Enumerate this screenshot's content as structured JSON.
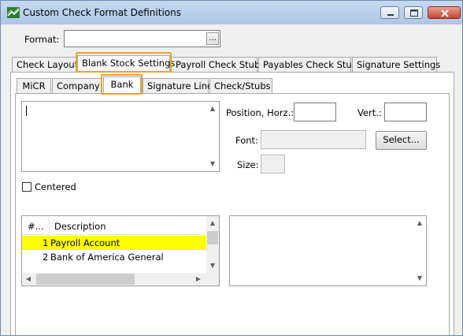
{
  "window": {
    "title": "Custom Check Format Definitions",
    "icon": "app-flag-icon"
  },
  "format": {
    "label": "Format:",
    "value": "",
    "browse_label": "..."
  },
  "main_tabs": [
    {
      "label": "Check Layout",
      "active": false
    },
    {
      "label": "Blank Stock Settings",
      "active": true
    },
    {
      "label": "Payroll Check Stub",
      "active": false
    },
    {
      "label": "Payables Check Stub",
      "active": false
    },
    {
      "label": "Signature Settings",
      "active": false
    }
  ],
  "sub_tabs": [
    {
      "label": "MiCR",
      "active": false
    },
    {
      "label": "Company",
      "active": false
    },
    {
      "label": "Bank",
      "active": true
    },
    {
      "label": "Signature Line",
      "active": false
    },
    {
      "label": "Check/Stubs",
      "active": false
    }
  ],
  "text_area": {
    "value": ""
  },
  "position": {
    "horz_label": "Position, Horz.:",
    "horz_value": "",
    "vert_label": "Vert.:",
    "vert_value": ""
  },
  "font": {
    "label": "Font:",
    "value": "",
    "select_label": "Select..."
  },
  "size": {
    "label": "Size:",
    "value": ""
  },
  "centered": {
    "label": "Centered",
    "checked": false
  },
  "bank_list": {
    "columns": [
      "#...",
      "Description"
    ],
    "rows": [
      {
        "num": "1",
        "description": "Payroll Account",
        "selected": true
      },
      {
        "num": "2",
        "description": "Bank of America General",
        "selected": false
      }
    ]
  },
  "colors": {
    "highlight_outline": "#f0a22a",
    "selected_row": "#ffff00",
    "titlebar": "#b8cfeb"
  }
}
